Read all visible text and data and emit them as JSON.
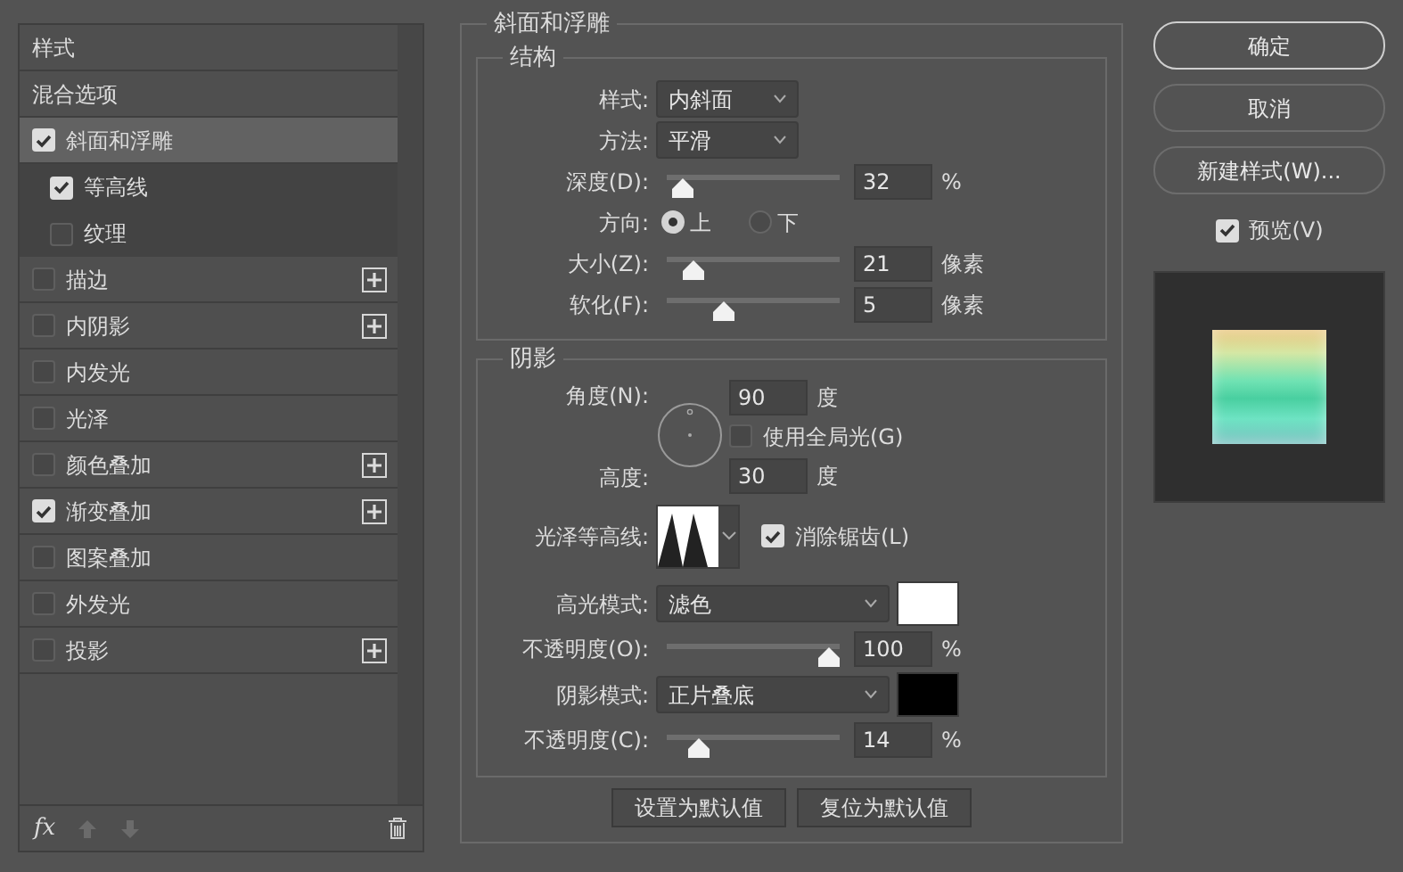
{
  "styles_panel": {
    "items": [
      {
        "kind": "header",
        "label": "样式",
        "selected": false
      },
      {
        "kind": "header",
        "label": "混合选项",
        "selected": false
      },
      {
        "kind": "effect",
        "label": "斜面和浮雕",
        "checked": true,
        "selected": true,
        "add_button": false,
        "children": [
          {
            "kind": "effect",
            "label": "等高线",
            "checked": true,
            "selected": false,
            "add_button": false
          },
          {
            "kind": "effect",
            "label": "纹理",
            "checked": false,
            "selected": false,
            "add_button": false
          }
        ]
      },
      {
        "kind": "effect",
        "label": "描边",
        "checked": false,
        "selected": false,
        "add_button": true
      },
      {
        "kind": "effect",
        "label": "内阴影",
        "checked": false,
        "selected": false,
        "add_button": true
      },
      {
        "kind": "effect",
        "label": "内发光",
        "checked": false,
        "selected": false,
        "add_button": false
      },
      {
        "kind": "effect",
        "label": "光泽",
        "checked": false,
        "selected": false,
        "add_button": false
      },
      {
        "kind": "effect",
        "label": "颜色叠加",
        "checked": false,
        "selected": false,
        "add_button": true
      },
      {
        "kind": "effect",
        "label": "渐变叠加",
        "checked": true,
        "selected": false,
        "add_button": true
      },
      {
        "kind": "effect",
        "label": "图案叠加",
        "checked": false,
        "selected": false,
        "add_button": false
      },
      {
        "kind": "effect",
        "label": "外发光",
        "checked": false,
        "selected": false,
        "add_button": false
      },
      {
        "kind": "effect",
        "label": "投影",
        "checked": false,
        "selected": false,
        "add_button": true
      }
    ],
    "footer": {
      "fx_label": "fx"
    }
  },
  "bevel": {
    "title": "斜面和浮雕",
    "structure": {
      "title": "结构",
      "rows": [
        {
          "kind": "select",
          "label": "样式:",
          "value": "内斜面"
        },
        {
          "kind": "select",
          "label": "方法:",
          "value": "平滑"
        },
        {
          "kind": "slider",
          "label": "深度(D):",
          "level": 0.03,
          "value": "32",
          "unit": "%"
        },
        {
          "kind": "radio",
          "label": "方向:",
          "options": [
            {
              "label": "上",
              "selected": true
            },
            {
              "label": "下",
              "selected": false
            }
          ]
        },
        {
          "kind": "slider",
          "label": "大小(Z):",
          "level": 0.1,
          "value": "21",
          "unit": "像素"
        },
        {
          "kind": "slider",
          "label": "软化(F):",
          "level": 0.3,
          "value": "5",
          "unit": "像素"
        }
      ]
    },
    "shading": {
      "title": "阴影",
      "angle": {
        "label": "角度(N):",
        "value": "90",
        "unit": "度"
      },
      "global_light": {
        "label": "使用全局光(G)",
        "checked": false
      },
      "altitude": {
        "label": "高度:",
        "value": "30",
        "unit": "度"
      },
      "gloss_contour": {
        "label": "光泽等高线:"
      },
      "anti_aliased": {
        "label": "消除锯齿(L)",
        "checked": true
      },
      "rows": [
        {
          "kind": "mode",
          "label": "高光模式:",
          "value": "滤色",
          "color": "#ffffff"
        },
        {
          "kind": "slider",
          "label": "不透明度(O):",
          "level": 1,
          "value": "100",
          "unit": "%"
        },
        {
          "kind": "mode",
          "label": "阴影模式:",
          "value": "正片叠底",
          "color": "#000000"
        },
        {
          "kind": "slider",
          "label": "不透明度(C):",
          "level": 0.14,
          "value": "14",
          "unit": "%"
        }
      ]
    },
    "default_buttons": [
      "设置为默认值",
      "复位为默认值"
    ]
  },
  "actions": {
    "buttons": [
      {
        "label": "确定",
        "default": true
      },
      {
        "label": "取消",
        "default": false
      },
      {
        "label": "新建样式(W)...",
        "default": false
      }
    ],
    "preview": {
      "label": "预览(V)",
      "checked": true
    }
  }
}
